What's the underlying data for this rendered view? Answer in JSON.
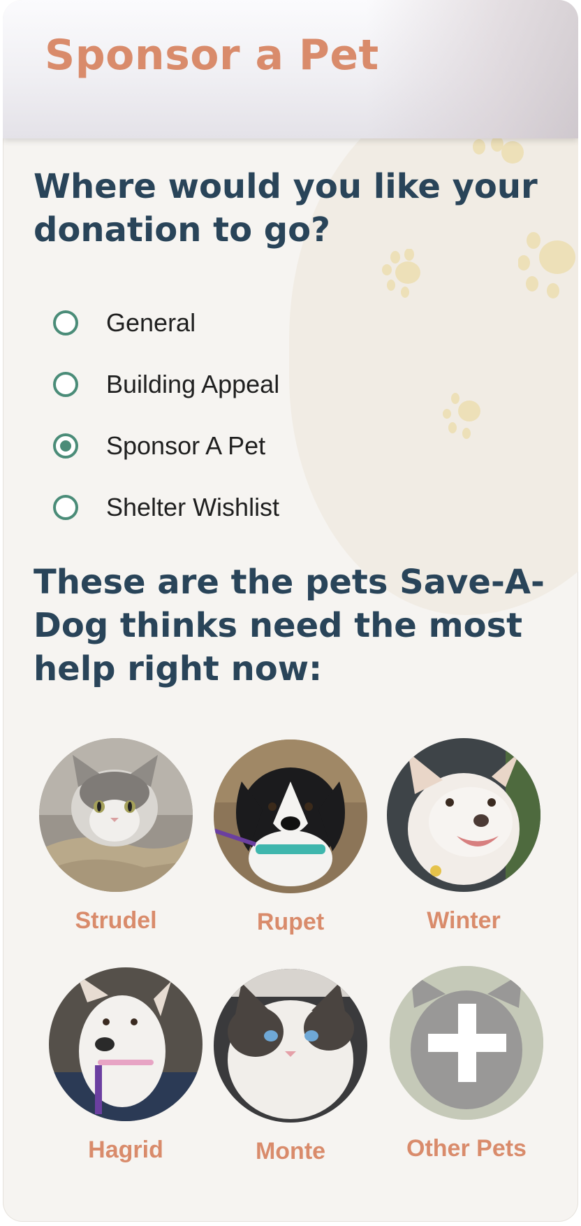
{
  "header": {
    "title": "Sponsor a Pet"
  },
  "donation": {
    "question": "Where would you like your donation to go?",
    "options": [
      {
        "label": "General",
        "selected": false
      },
      {
        "label": "Building Appeal",
        "selected": false
      },
      {
        "label": "Sponsor A Pet",
        "selected": true
      },
      {
        "label": "Shelter Wishlist",
        "selected": false
      }
    ]
  },
  "pets_section": {
    "heading": "These are the pets Save-A-Dog thinks need the most help right now:",
    "pets": [
      {
        "name": "Strudel",
        "photo": "gray-white-kitten-photo"
      },
      {
        "name": "Rupet",
        "photo": "black-white-dog-photo"
      },
      {
        "name": "Winter",
        "photo": "white-dog-photo"
      },
      {
        "name": "Hagrid",
        "photo": "white-dog-purple-collar-photo"
      },
      {
        "name": "Monte",
        "photo": "white-gray-cat-photo"
      },
      {
        "name": "Other Pets",
        "photo": "faded-black-dog-photo",
        "overlay_icon": "plus-icon"
      }
    ]
  },
  "colors": {
    "accent_orange": "#d98b6b",
    "heading_navy": "#294459",
    "radio_green": "#4a8c78",
    "background": "#f6f4f1",
    "paw_tan": "#ede0b8"
  }
}
